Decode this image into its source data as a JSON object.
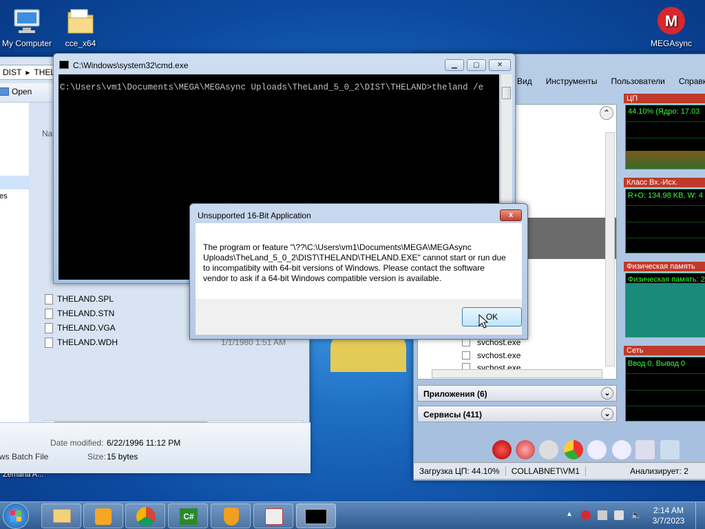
{
  "desktop": {
    "icons": [
      {
        "label": "My Computer",
        "icon": "computer-icon"
      },
      {
        "label": "cce_x64",
        "icon": "folder-icon"
      },
      {
        "label": "MEGAsync",
        "icon": "megasync-icon"
      }
    ],
    "partial_label": "Zemana A..."
  },
  "explorer": {
    "breadcrumb": [
      "DIST",
      "THELA"
    ],
    "open_label": "Open",
    "column_name": "Na",
    "side_partial": "es",
    "files": [
      "THELAND.SPL",
      "THELAND.STN",
      "THELAND.VGA",
      "THELAND.WDH"
    ],
    "last_file_date": "1/1/1980 1:51 AM",
    "details": {
      "modified_label": "Date modified:",
      "modified_value": "6/22/1996 11:12 PM",
      "size_label": "Size:",
      "size_value": "15 bytes",
      "type_partial": "ws Batch File"
    }
  },
  "cmd": {
    "title": "C:\\Windows\\system32\\cmd.exe",
    "console_text": "C:\\Users\\vm1\\Documents\\MEGA\\MEGAsync Uploads\\TheLand_5_0_2\\DIST\\THELAND>theland /e"
  },
  "dialog": {
    "title": "Unsupported 16-Bit Application",
    "message": "The program or feature \"\\??\\C:\\Users\\vm1\\Documents\\MEGA\\MEGAsync Uploads\\TheLand_5_0_2\\DIST\\THELAND\\THELAND.EXE\" cannot start or run due to incompatibity with 64-bit versions of Windows. Please contact the software vendor to ask if a 64-bit Windows compatible version is available.",
    "ok_label": "OK",
    "close_label": "x"
  },
  "taskmgr": {
    "menu": [
      "Вид",
      "Инструменты",
      "Пользователи",
      "Справка"
    ],
    "processes": [
      "svchost.exe",
      "svchost.exe",
      "svchost.exe"
    ],
    "categories": [
      {
        "label": "Приложения (6)"
      },
      {
        "label": "Сервисы (411)"
      }
    ],
    "graphs": [
      {
        "title": "ЦП",
        "readout": "44.10% (Ядро: 17.03"
      },
      {
        "title": "Класс Вх.-Исх.",
        "readout": "R+O: 134.98 KB, W: 4"
      },
      {
        "title": "Физическая память",
        "readout": "Физическая память: 2"
      },
      {
        "title": "Сеть",
        "readout": "Ввод 0, Вывод 0"
      }
    ],
    "status": {
      "cpu": "Загрузка ЦП: 44.10%",
      "user": "COLLABNET\\VM1",
      "analyzing": "Анализирует: 2"
    }
  },
  "taskbar": {
    "clock_time": "2:14 AM",
    "clock_date": "3/7/2023",
    "buttons": [
      "explorer-icon",
      "media-player-icon",
      "chrome-icon",
      "csharp-icon",
      "shield-icon",
      "tools-icon",
      "cmd-icon"
    ]
  },
  "colors": {
    "accent": "#1e6fc4",
    "dialog_close": "#c2432c",
    "graph_green": "#33ff33"
  }
}
